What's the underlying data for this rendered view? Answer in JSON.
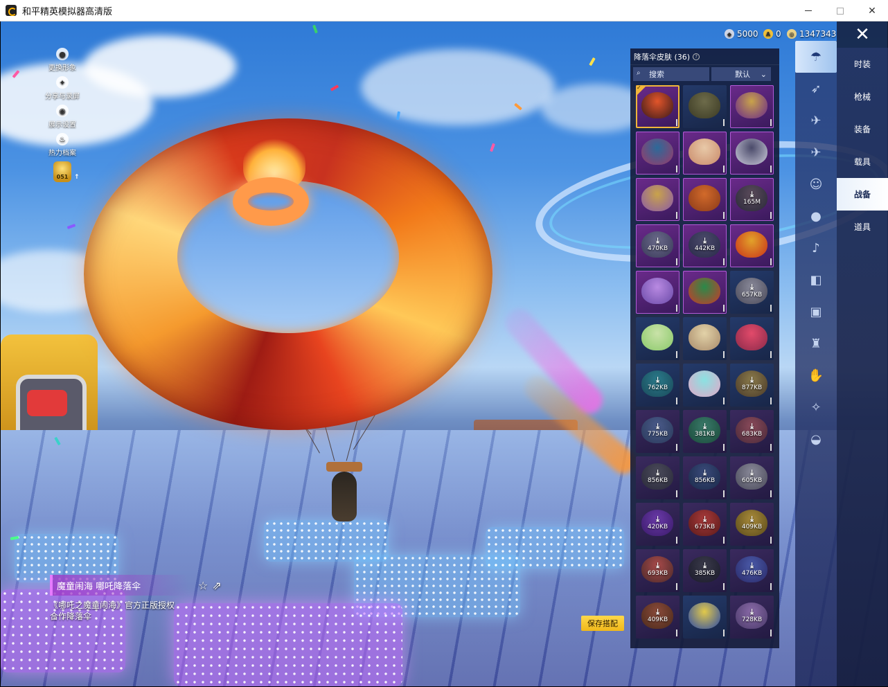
{
  "window": {
    "title": "和平精英模拟器高清版",
    "minimize_label": "—",
    "close_label": "✕"
  },
  "hud_left": [
    {
      "label": "更换形象",
      "icon": "person-icon"
    },
    {
      "label": "分享与录屏",
      "icon": "share-record-icon"
    },
    {
      "label": "展示设置",
      "icon": "eye-icon"
    },
    {
      "label": "热力档案",
      "icon": "flame-icon"
    }
  ],
  "level": "051",
  "currency": {
    "silver": "5000",
    "gold": "0",
    "coupon": "1347343"
  },
  "close_icon": "✕",
  "categories": [
    {
      "label": "时装",
      "active": false
    },
    {
      "label": "枪械",
      "active": false
    },
    {
      "label": "装备",
      "active": false
    },
    {
      "label": "载具",
      "active": false
    },
    {
      "label": "战备",
      "active": true
    },
    {
      "label": "道具",
      "active": false
    }
  ],
  "sub_categories": [
    {
      "icon": "parachute-icon",
      "active": true
    },
    {
      "icon": "glider-icon",
      "active": false
    },
    {
      "icon": "drone-icon",
      "active": false
    },
    {
      "icon": "plane-icon",
      "active": false
    },
    {
      "icon": "emote-icon",
      "active": false
    },
    {
      "icon": "pet-icon",
      "active": false
    },
    {
      "icon": "speaker-icon",
      "active": false
    },
    {
      "icon": "spray-icon",
      "active": false
    },
    {
      "icon": "picture-icon",
      "active": false
    },
    {
      "icon": "extinguisher-icon",
      "active": false
    },
    {
      "icon": "hand-icon",
      "active": false
    },
    {
      "icon": "wand-icon",
      "active": false
    },
    {
      "icon": "hat-icon",
      "active": false
    }
  ],
  "panel": {
    "title": "降落伞皮肤 (36)",
    "search_label": "搜索",
    "sort_label": "默认"
  },
  "items": [
    {
      "style": "purple",
      "selected": true,
      "colors": [
        "#e2552a",
        "#3a1a1a"
      ],
      "size": ""
    },
    {
      "style": "blue",
      "selected": false,
      "colors": [
        "#6d6b4a",
        "#3b3a24"
      ],
      "size": ""
    },
    {
      "style": "purple",
      "selected": false,
      "colors": [
        "#c9a34a",
        "#6a2a8a"
      ],
      "size": ""
    },
    {
      "style": "purple",
      "selected": false,
      "colors": [
        "#2c6a9a",
        "#9a3a6a"
      ],
      "size": ""
    },
    {
      "style": "purple",
      "selected": false,
      "colors": [
        "#e8c9a8",
        "#c98a6a"
      ],
      "size": ""
    },
    {
      "style": "purple",
      "selected": false,
      "colors": [
        "#4a4a6a",
        "#c9c9d9"
      ],
      "size": ""
    },
    {
      "style": "purple",
      "selected": false,
      "colors": [
        "#c9a34a",
        "#8a5aa8"
      ],
      "size": ""
    },
    {
      "style": "purple",
      "selected": false,
      "colors": [
        "#d26a2a",
        "#8a3a1a"
      ],
      "size": ""
    },
    {
      "style": "purple",
      "selected": false,
      "colors": [
        "#5a4a5a",
        "#2a2a3a"
      ],
      "size": "165M"
    },
    {
      "style": "purple",
      "selected": false,
      "colors": [
        "#6a6a8a",
        "#3a3a5a"
      ],
      "size": "470KB"
    },
    {
      "style": "purple",
      "selected": false,
      "colors": [
        "#4a4a6a",
        "#2a2a4a"
      ],
      "size": "442KB"
    },
    {
      "style": "purple",
      "selected": false,
      "colors": [
        "#e2a22a",
        "#c9321a"
      ],
      "size": ""
    },
    {
      "style": "purple",
      "selected": false,
      "colors": [
        "#b98ae2",
        "#6a4aa8"
      ],
      "size": ""
    },
    {
      "style": "purple",
      "selected": false,
      "colors": [
        "#2a8a4a",
        "#c93a2a"
      ],
      "size": ""
    },
    {
      "style": "blue",
      "selected": false,
      "colors": [
        "#8a8a9a",
        "#4a4a5a"
      ],
      "size": "657KB"
    },
    {
      "style": "blue",
      "selected": false,
      "colors": [
        "#c9e2a8",
        "#8ac96a"
      ],
      "size": ""
    },
    {
      "style": "blue",
      "selected": false,
      "colors": [
        "#e2d2a8",
        "#a88a6a"
      ],
      "size": ""
    },
    {
      "style": "blue",
      "selected": false,
      "colors": [
        "#e24a6a",
        "#8a2a4a"
      ],
      "size": ""
    },
    {
      "style": "blue",
      "selected": false,
      "colors": [
        "#2a7a8a",
        "#1a4a5a"
      ],
      "size": "762KB"
    },
    {
      "style": "blue",
      "selected": false,
      "colors": [
        "#8ae2e2",
        "#e2a8c9"
      ],
      "size": ""
    },
    {
      "style": "blue",
      "selected": false,
      "colors": [
        "#8a7a4a",
        "#4a3a2a"
      ],
      "size": "877KB"
    },
    {
      "style": "default",
      "selected": false,
      "colors": [
        "#4a5a8a",
        "#2a3a5a"
      ],
      "size": "775KB"
    },
    {
      "style": "default",
      "selected": false,
      "colors": [
        "#3a7a6a",
        "#1a4a3a"
      ],
      "size": "381KB"
    },
    {
      "style": "default",
      "selected": false,
      "colors": [
        "#8a4a5a",
        "#4a2a3a"
      ],
      "size": "683KB"
    },
    {
      "style": "default",
      "selected": false,
      "colors": [
        "#4a4a5a",
        "#2a2a3a"
      ],
      "size": "856KB"
    },
    {
      "style": "default",
      "selected": false,
      "colors": [
        "#3a4a7a",
        "#1a2a4a"
      ],
      "size": "856KB"
    },
    {
      "style": "default",
      "selected": false,
      "colors": [
        "#8a8a9a",
        "#4a4a5a"
      ],
      "size": "605KB"
    },
    {
      "style": "default",
      "selected": false,
      "colors": [
        "#6a3aa8",
        "#3a1a6a"
      ],
      "size": "420KB"
    },
    {
      "style": "default",
      "selected": false,
      "colors": [
        "#a83a3a",
        "#5a1a1a"
      ],
      "size": "673KB"
    },
    {
      "style": "default",
      "selected": false,
      "colors": [
        "#a88a3a",
        "#5a4a1a"
      ],
      "size": "409KB"
    },
    {
      "style": "default",
      "selected": false,
      "colors": [
        "#a84a4a",
        "#4a2a2a"
      ],
      "size": "693KB"
    },
    {
      "style": "default",
      "selected": false,
      "colors": [
        "#3a3a4a",
        "#1a1a2a"
      ],
      "size": "385KB"
    },
    {
      "style": "default",
      "selected": false,
      "colors": [
        "#4a5aa8",
        "#2a2a6a"
      ],
      "size": "476KB"
    },
    {
      "style": "default",
      "selected": false,
      "colors": [
        "#8a4a3a",
        "#4a2a1a"
      ],
      "size": "409KB"
    },
    {
      "style": "blue",
      "selected": false,
      "colors": [
        "#e2c94a",
        "#2a4aa8"
      ],
      "size": ""
    },
    {
      "style": "default",
      "selected": false,
      "colors": [
        "#8a6aa8",
        "#4a3a6a"
      ],
      "size": "728KB"
    }
  ],
  "item_detail": {
    "name": "魔童闹海 哪吒降落伞",
    "description": "《哪吒之魔童闹海》官方正版授权合作降落伞"
  },
  "save_label": "保存搭配"
}
